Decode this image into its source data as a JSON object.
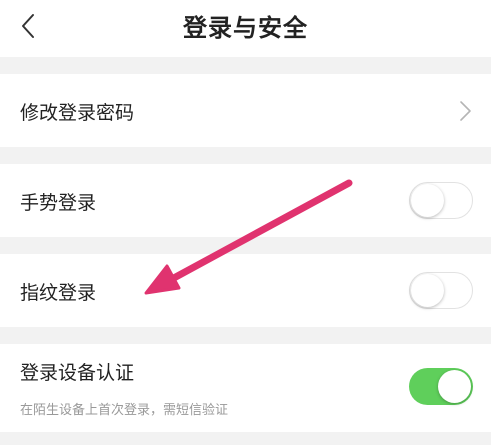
{
  "header": {
    "title": "登录与安全",
    "back_icon": "chevron-left-icon"
  },
  "rows": {
    "change_password": {
      "label": "修改登录密码",
      "icon": "chevron-right-icon"
    },
    "gesture_login": {
      "label": "手势登录",
      "toggle_on": false
    },
    "fingerprint_login": {
      "label": "指纹登录",
      "toggle_on": false
    },
    "device_verification": {
      "label": "登录设备认证",
      "sublabel": "在陌生设备上首次登录，需短信验证",
      "toggle_on": true
    }
  },
  "colors": {
    "toggle_on": "#5fcf5b",
    "arrow_annotation": "#e0336f",
    "background": "#f2f2f2"
  }
}
